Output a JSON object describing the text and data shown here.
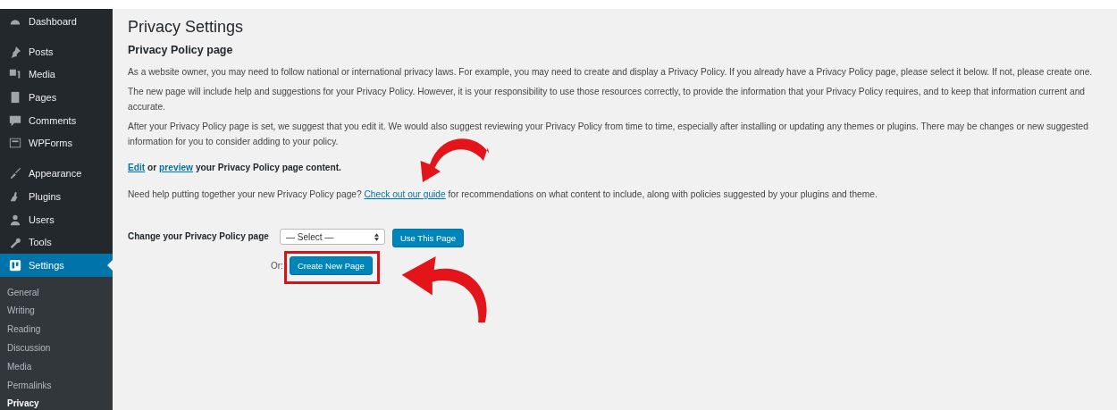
{
  "sidebar": {
    "groups": [
      {
        "items": [
          {
            "label": "Dashboard",
            "selected": false
          }
        ]
      },
      {
        "items": [
          {
            "label": "Posts",
            "selected": false
          },
          {
            "label": "Media",
            "selected": false
          },
          {
            "label": "Pages",
            "selected": false
          },
          {
            "label": "Comments",
            "selected": false
          },
          {
            "label": "WPForms",
            "selected": false
          }
        ]
      },
      {
        "items": [
          {
            "label": "Appearance",
            "selected": false
          },
          {
            "label": "Plugins",
            "selected": false
          },
          {
            "label": "Users",
            "selected": false
          },
          {
            "label": "Tools",
            "selected": false
          },
          {
            "label": "Settings",
            "selected": true
          }
        ]
      }
    ],
    "submenu": [
      {
        "label": "General",
        "selected": false
      },
      {
        "label": "Writing",
        "selected": false
      },
      {
        "label": "Reading",
        "selected": false
      },
      {
        "label": "Discussion",
        "selected": false
      },
      {
        "label": "Media",
        "selected": false
      },
      {
        "label": "Permalinks",
        "selected": false
      },
      {
        "label": "Privacy",
        "selected": true
      }
    ]
  },
  "page_title": "Privacy Settings",
  "section_title": "Privacy Policy page",
  "paragraphs": [
    [
      {
        "kind": "text",
        "text": "As a website owner, you may need to follow national or international privacy laws. For example, you may need to create and display a Privacy Policy. If you already have a Privacy Policy page, please select it below. If not, please create one."
      }
    ],
    [
      {
        "kind": "text",
        "text": "The new page will include help and suggestions for your Privacy Policy. However, it is your responsibility to use those resources correctly, to provide the information that your Privacy Policy requires, and to keep that information current and accurate."
      }
    ],
    [
      {
        "kind": "text",
        "text": "After your Privacy Policy page is set, we suggest that you edit it. We would also suggest reviewing your Privacy Policy from time to time, especially after installing or updating any themes or plugins. There may be changes or new suggested information for you to consider adding to your policy."
      }
    ],
    [
      {
        "kind": "link",
        "text": "Edit"
      },
      {
        "kind": "bold",
        "text": " or "
      },
      {
        "kind": "link",
        "text": "preview"
      },
      {
        "kind": "bold",
        "text": " your Privacy Policy page content."
      }
    ],
    [
      {
        "kind": "text",
        "text": "Need help putting together your new Privacy Policy page? "
      },
      {
        "kind": "link",
        "text": "Check out our guide"
      },
      {
        "kind": "text",
        "text": " for recommendations on what content to include, along with policies suggested by your plugins and theme."
      }
    ]
  ],
  "change_label": "Change your Privacy Policy page",
  "select": {
    "value": "— Select —"
  },
  "use_button": "Use This Page",
  "or_label": "Or:",
  "create_button": "Create New Page"
}
